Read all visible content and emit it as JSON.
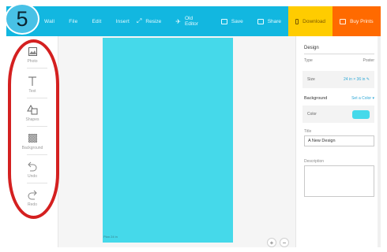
{
  "step_badge": "5",
  "topbar": {
    "menu": [
      "Wall",
      "File",
      "Edit",
      "Insert"
    ],
    "resize_label": "Resize",
    "old_editor_label": "Old Editor",
    "save_label": "Save",
    "share_label": "Share",
    "download_label": "Download",
    "buy_prints_label": "Buy Prints"
  },
  "sidebar": {
    "tools": [
      {
        "label": "Photo",
        "icon": "photo-icon"
      },
      {
        "label": "Text",
        "icon": "text-icon"
      },
      {
        "label": "Shapes",
        "icon": "shapes-icon"
      },
      {
        "label": "Background",
        "icon": "background-icon"
      },
      {
        "label": "Undo",
        "icon": "undo-icon"
      },
      {
        "label": "Redo",
        "icon": "redo-icon"
      }
    ]
  },
  "canvas": {
    "color": "#45d9ea",
    "footer_label": "Plan 24 in",
    "zoom_in": "+",
    "zoom_out": "−"
  },
  "panel": {
    "title": "Design",
    "type_label": "Type",
    "type_value": "Poster",
    "size_label": "Size",
    "size_value": "24 in × 36 in",
    "background_label": "Background",
    "background_action": "Set a Color",
    "color_label": "Color",
    "color_value": "#45d9ea",
    "title_label": "Title",
    "title_value": "A New Design",
    "description_label": "Description"
  },
  "colors": {
    "topbar": "#12b7e0",
    "download": "#ffcc00",
    "buy_prints": "#ff6a00",
    "highlight": "#d42020"
  }
}
